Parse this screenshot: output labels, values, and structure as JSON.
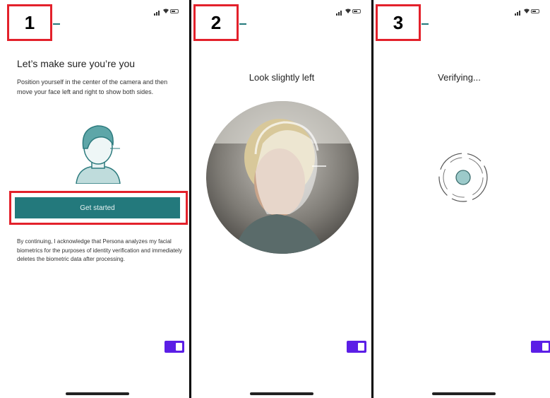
{
  "steps": [
    {
      "number": "1"
    },
    {
      "number": "2",
      "title": "Look slightly left"
    },
    {
      "number": "3",
      "title": "Verifying..."
    }
  ],
  "screen1": {
    "heading": "Let’s make sure you’re you",
    "description": "Position yourself in the center of the camera and then move your face left and right to show both sides.",
    "cta_label": "Get started",
    "legal": "By continuing, I acknowledge that Persona analyzes my facial biometrics for the purposes of identity verification and immediately deletes the biometric data after processing."
  },
  "colors": {
    "accent": "#23797c",
    "highlight": "#e3212b",
    "toggle": "#5b1ee6"
  },
  "icons": [
    "signal-icon",
    "wifi-icon",
    "battery-icon",
    "face-illustration",
    "verifying-spinner-icon",
    "toggle-icon"
  ]
}
